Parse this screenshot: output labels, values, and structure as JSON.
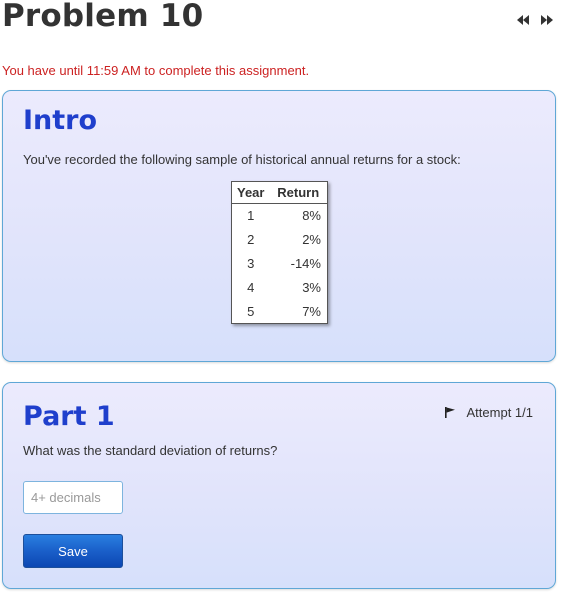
{
  "header": {
    "title": "Problem 10",
    "nav_prev_icon": "rewind-icon",
    "nav_next_icon": "fast-forward-icon"
  },
  "deadline_text": "You have until 11:59 AM to complete this assignment.",
  "intro": {
    "heading": "Intro",
    "text": "You've recorded the following sample of historical annual returns for a stock:",
    "table": {
      "headers": [
        "Year",
        "Return"
      ],
      "rows": [
        {
          "year": "1",
          "return": "8%"
        },
        {
          "year": "2",
          "return": "2%"
        },
        {
          "year": "3",
          "return": "-14%"
        },
        {
          "year": "4",
          "return": "3%"
        },
        {
          "year": "5",
          "return": "7%"
        }
      ]
    }
  },
  "part1": {
    "heading": "Part 1",
    "attempt_label": "Attempt 1/1",
    "flag_icon": "flag-icon",
    "question": "What was the standard deviation of returns?",
    "input_value": "",
    "input_placeholder": "4+ decimals",
    "save_label": "Save"
  },
  "colors": {
    "heading_blue": "#1f3fcc",
    "deadline_red": "#cc2222",
    "panel_border": "#5fa7d6",
    "button_blue": "#1a5fc9"
  }
}
